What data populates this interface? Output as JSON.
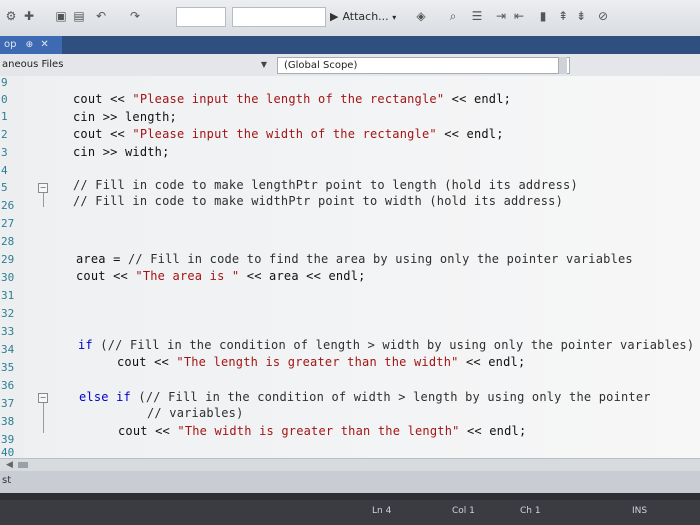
{
  "toolbar": {
    "attach_label": "Attach...",
    "icons": [
      "undo-icon",
      "redo-icon",
      "save-icon",
      "save-all-icon",
      "play-icon",
      "bookmark-icon"
    ]
  },
  "tabstrip": {
    "tab_label": "op",
    "pin_glyph": "⊕",
    "close_glyph": "✕"
  },
  "navbar": {
    "project_label": "aneous Files",
    "scope_label": "(Global Scope)"
  },
  "editor": {
    "line_numbers": [
      "9",
      "0",
      "1",
      "2",
      "3",
      "4",
      "5",
      "26",
      "27",
      "28",
      "29",
      "30",
      "31",
      "32",
      "33",
      "34",
      "35",
      "36",
      "37",
      "38",
      "39",
      "40"
    ],
    "code": {
      "l1_a": "cout << ",
      "l1_s": "\"Please input the length of the rectangle\"",
      "l1_b": " << endl;",
      "l2": "cin >> length;",
      "l3_a": "cout << ",
      "l3_s": "\"Please input the width of the rectangle\"",
      "l3_b": " << endl;",
      "l4": "cin >> width;",
      "c1": "// Fill in code to make lengthPtr point to length (hold its address)",
      "c2": "// Fill in code to make widthPtr point to width (hold its address)",
      "area_a": "area = ",
      "area_c": "// Fill in code to find the area by using only the pointer variables",
      "area_out_a": "cout << ",
      "area_out_s": "\"The area is \"",
      "area_out_b": " << area << endl;",
      "if_kw": "if",
      "if_rest": " (// Fill in the condition of length > width by using only the pointer variables)",
      "if_out_a": "cout << ",
      "if_out_s": "\"The length is greater than the width\"",
      "if_out_b": " << endl;",
      "else_kw": "else if",
      "else_rest": " (// Fill in the condition of width > length by using only the pointer",
      "else_cont": "// variables)",
      "else_out_a": "cout << ",
      "else_out_s": "\"The width is greater than the length\"",
      "else_out_b": " << endl;"
    }
  },
  "bottom": {
    "panel_label": "st",
    "status_items": [
      "Ln 4",
      "Col 1",
      "Ch 1",
      "INS"
    ]
  },
  "colors": {
    "string": "#a31515",
    "keyword": "#0000cc",
    "line_number": "#2c7f93",
    "tab_active": "#3d6ab2"
  }
}
